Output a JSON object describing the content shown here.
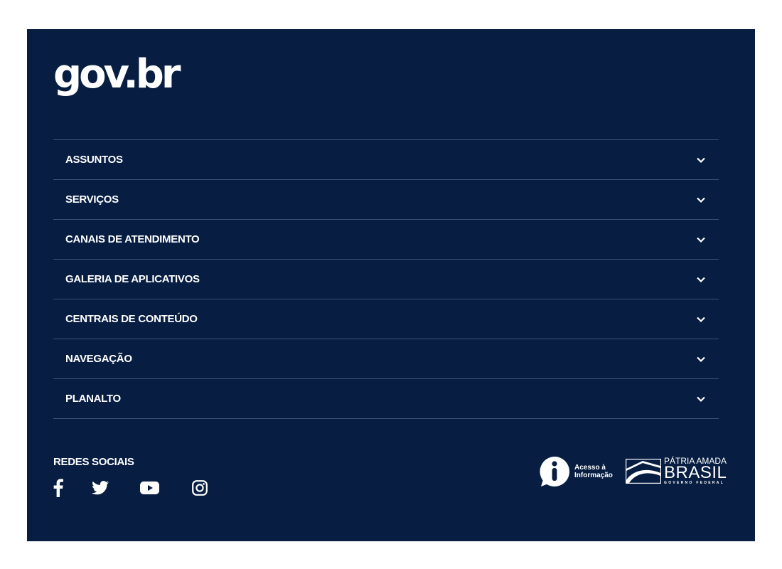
{
  "logo": "gov.br",
  "menu": [
    {
      "label": "ASSUNTOS"
    },
    {
      "label": "SERVIÇOS"
    },
    {
      "label": "CANAIS DE ATENDIMENTO"
    },
    {
      "label": "GALERIA DE APLICATIVOS"
    },
    {
      "label": "CENTRAIS DE CONTEÚDO"
    },
    {
      "label": "NAVEGAÇÃO"
    },
    {
      "label": "PLANALTO"
    }
  ],
  "social": {
    "title": "REDES SOCIAIS",
    "icons": [
      "facebook-icon",
      "twitter-icon",
      "youtube-icon",
      "instagram-icon"
    ]
  },
  "acesso": {
    "line1": "Acesso à",
    "line2": "Informação"
  },
  "patria": {
    "line1": "PÁTRIA AMADA",
    "line2": "BRASIL",
    "line3": "GOVERNO FEDERAL"
  },
  "colors": {
    "background": "#071d41",
    "divider": "#3d5173",
    "text": "#ffffff"
  }
}
